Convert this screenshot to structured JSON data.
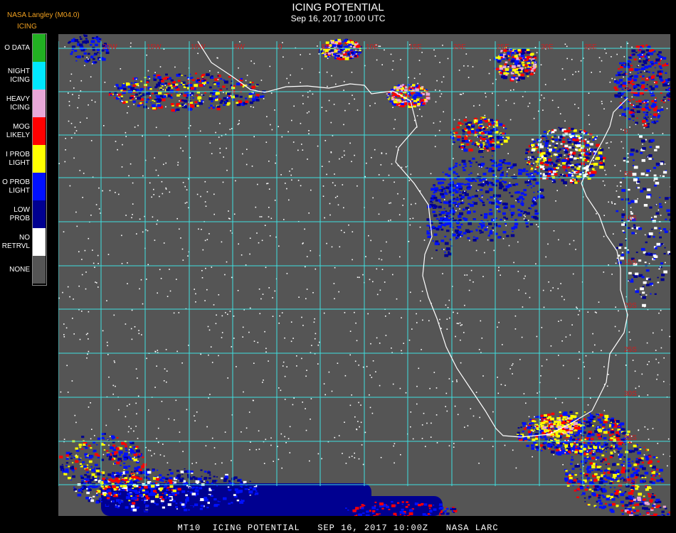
{
  "header": {
    "agency": "NASA Langley (M04.0)",
    "product": "ICING",
    "title": "ICING POTENTIAL",
    "datetime": "Sep 16, 2017 10:00 UTC"
  },
  "legend": [
    {
      "lines": [
        "O DATA"
      ],
      "color": "#22b022"
    },
    {
      "lines": [
        "NIGHT",
        "ICING"
      ],
      "color": "#00e8ff"
    },
    {
      "lines": [
        "HEAVY",
        "ICING"
      ],
      "color": "#e8a8d8"
    },
    {
      "lines": [
        "MOG",
        "LIKELY"
      ],
      "color": "#ff0000"
    },
    {
      "lines": [
        "I PROB",
        "LIGHT"
      ],
      "color": "#ffff00"
    },
    {
      "lines": [
        "O PROB",
        "LIGHT"
      ],
      "color": "#0010ff"
    },
    {
      "lines": [
        "LOW",
        "PROB"
      ],
      "color": "#000090"
    },
    {
      "lines": [
        "NO",
        "RETRVL"
      ],
      "color": "#ffffff"
    },
    {
      "lines": [
        "NONE"
      ],
      "color": "#555555"
    }
  ],
  "map": {
    "background": "#555555",
    "grid_color": "#40e0e0",
    "coast_color": "#ffffff",
    "lon_labels": [
      "20W",
      "15W",
      "10W",
      "5W",
      "0",
      "5E",
      "10E",
      "15E",
      "20E",
      "25E",
      "30E",
      "35E"
    ],
    "lat_labels": [
      "5N",
      "0",
      "5S",
      "10S",
      "15S",
      "20S",
      "25S",
      "30S",
      "35S",
      "40S"
    ]
  },
  "footer": "MT10  ICING POTENTIAL   SEP 16, 2017 10:00Z   NASA LARC"
}
